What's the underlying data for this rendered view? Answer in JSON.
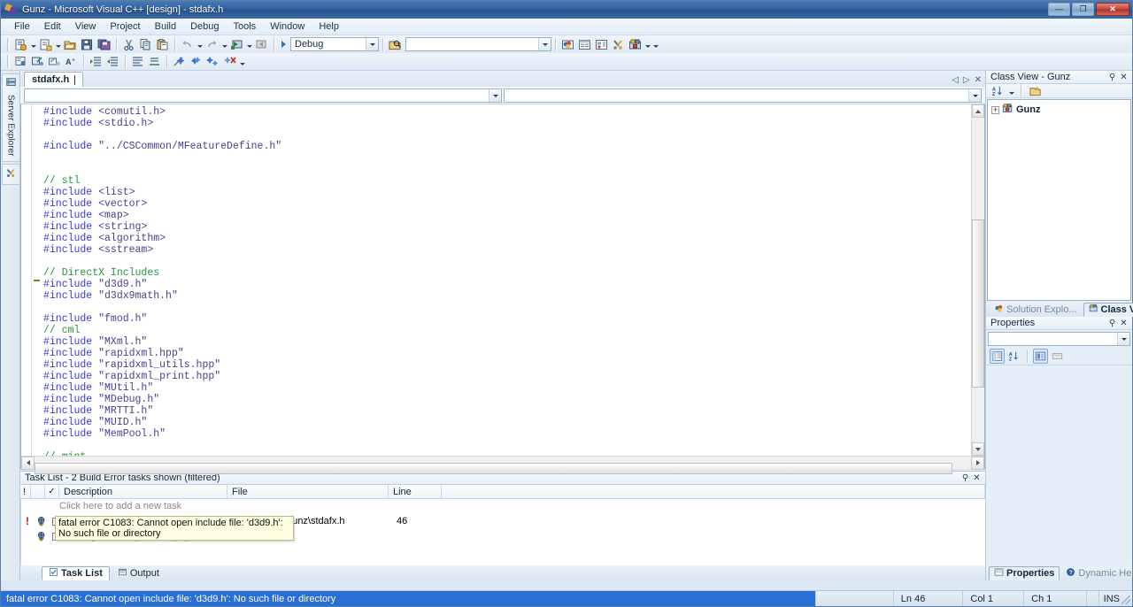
{
  "window": {
    "title": "Gunz - Microsoft Visual C++ [design] - stdafx.h",
    "minimize_label": "—",
    "maximize_label": "❐",
    "close_label": "✕"
  },
  "menu": {
    "items": [
      "File",
      "Edit",
      "View",
      "Project",
      "Build",
      "Debug",
      "Tools",
      "Window",
      "Help"
    ]
  },
  "toolbar": {
    "config_value": "Debug",
    "find_value": "",
    "icons_row1": [
      "new-item-icon",
      "new-project-icon",
      "open-file-icon",
      "save-icon",
      "save-all-icon",
      "cut-icon",
      "copy-icon",
      "paste-icon",
      "undo-icon",
      "redo-icon",
      "navigate-backward-icon",
      "navigate-forward-icon"
    ],
    "icons_row2": [
      "toggle-bookmark-icon",
      "comment-icon",
      "uncomment-icon",
      "font-size-icon",
      "indent-icon",
      "outdent-icon",
      "format-icon",
      "align-icon",
      "next-bookmark-icon",
      "prev-bookmark-icon",
      "clear-bookmarks-icon",
      "delete-bookmark-icon"
    ],
    "icons_right": [
      "solution-explorer-icon",
      "properties-window-icon",
      "object-browser-icon",
      "toolbox-icon",
      "class-view-icon"
    ]
  },
  "left_strip": {
    "tabs": [
      {
        "label": "Server Explorer",
        "icon": "server-explorer-icon"
      },
      {
        "label": "",
        "icon": "toolbox-icon"
      }
    ]
  },
  "editor": {
    "tab_label": "stdafx.h",
    "nav_prev": "◁",
    "nav_next": "▷",
    "close": "✕",
    "objects_combo": "",
    "members_combo": "",
    "code_lines": [
      {
        "t": "pp",
        "text": "#include <comutil.h>"
      },
      {
        "t": "pp",
        "text": "#include <stdio.h>"
      },
      {
        "t": "blank",
        "text": ""
      },
      {
        "t": "pp",
        "text": "#include \"../CSCommon/MFeatureDefine.h\""
      },
      {
        "t": "blank",
        "text": ""
      },
      {
        "t": "blank",
        "text": ""
      },
      {
        "t": "cmt",
        "text": "// stl"
      },
      {
        "t": "pp",
        "text": "#include <list>"
      },
      {
        "t": "pp",
        "text": "#include <vector>"
      },
      {
        "t": "pp",
        "text": "#include <map>"
      },
      {
        "t": "pp",
        "text": "#include <string>"
      },
      {
        "t": "pp",
        "text": "#include <algorithm>"
      },
      {
        "t": "pp",
        "text": "#include <sstream>"
      },
      {
        "t": "blank",
        "text": ""
      },
      {
        "t": "cmt",
        "text": "// DirectX Includes"
      },
      {
        "t": "pp",
        "text": "#include \"d3d9.h\""
      },
      {
        "t": "pp",
        "text": "#include \"d3dx9math.h\""
      },
      {
        "t": "blank",
        "text": ""
      },
      {
        "t": "pp",
        "text": "#include \"fmod.h\""
      },
      {
        "t": "cmt",
        "text": "// cml"
      },
      {
        "t": "pp",
        "text": "#include \"MXml.h\""
      },
      {
        "t": "pp",
        "text": "#include \"rapidxml.hpp\""
      },
      {
        "t": "pp",
        "text": "#include \"rapidxml_utils.hpp\""
      },
      {
        "t": "pp",
        "text": "#include \"rapidxml_print.hpp\""
      },
      {
        "t": "pp",
        "text": "#include \"MUtil.h\""
      },
      {
        "t": "pp",
        "text": "#include \"MDebug.h\""
      },
      {
        "t": "pp",
        "text": "#include \"MRTTI.h\""
      },
      {
        "t": "pp",
        "text": "#include \"MUID.h\""
      },
      {
        "t": "pp",
        "text": "#include \"MemPool.h\""
      },
      {
        "t": "blank",
        "text": ""
      },
      {
        "t": "cmt",
        "text": "// mint"
      }
    ]
  },
  "tasklist": {
    "caption": "Task List - 2 Build Error tasks shown (filtered)",
    "pin_label": "⚲",
    "close_label": "✕",
    "columns": [
      "!",
      "",
      "",
      "Description",
      "File",
      "Line",
      ""
    ],
    "new_task_placeholder": "Click here to add a new task",
    "rows": [
      {
        "priority": "!",
        "icon": "build-error-icon",
        "checked": false,
        "description": "fatal error C1083: Cannot open include file: 'd3d9.h': No such file or directory",
        "file": "p\\...\\Stable\\Gunz\\stdafx.h",
        "line": "46"
      },
      {
        "priority": "",
        "icon": "build-error-icon",
        "checked": false,
        "description": "warning C4005: '_D3DX9_H_' : macro redefinition",
        "file": "",
        "line": ""
      }
    ],
    "tooltip": "fatal error C1083: Cannot open include file: 'd3d9.h': No such file or directory",
    "tabs": [
      {
        "label": "Task List",
        "icon": "task-list-icon",
        "active": true
      },
      {
        "label": "Output",
        "icon": "output-icon",
        "active": false
      }
    ]
  },
  "classview": {
    "caption": "Class View - Gunz",
    "pin_label": "⚲",
    "close_label": "✕",
    "sort_icon": "sort-alphabetical-icon",
    "newfolder_icon": "new-folder-icon",
    "root_node": "Gunz",
    "root_expander": "+",
    "tabs": [
      {
        "label": "Solution Explo...",
        "icon": "solution-explorer-icon",
        "active": false
      },
      {
        "label": "Class View",
        "icon": "class-view-icon",
        "active": true
      }
    ]
  },
  "properties": {
    "caption": "Properties",
    "pin_label": "⚲",
    "close_label": "✕",
    "selector_value": "",
    "buttons": [
      {
        "name": "categorized-button",
        "selected": true
      },
      {
        "name": "alphabetical-button",
        "selected": false
      },
      {
        "name": "property-pages-button",
        "selected": true
      },
      {
        "name": "property-events-button",
        "selected": false
      }
    ]
  },
  "dockbar_right": {
    "tabs": [
      {
        "label": "Properties",
        "icon": "properties-icon",
        "active": true
      },
      {
        "label": "Dynamic Help",
        "icon": "help-icon",
        "active": false
      }
    ]
  },
  "statusbar": {
    "message": "fatal error C1083: Cannot open include file: 'd3d9.h': No such file or directory",
    "line": "Ln 46",
    "column": "Col 1",
    "character": "Ch 1",
    "insert_mode": "INS"
  },
  "colors": {
    "accent_blue": "#2a6fd4",
    "title_blue": "#2f5f9e",
    "comment_green": "#1f9a3c",
    "preprocessor_blue": "#3a3ad6",
    "string_purple": "#4a3f8f",
    "error_red": "#cc1111",
    "tooltip_bg": "#ffffe1"
  }
}
